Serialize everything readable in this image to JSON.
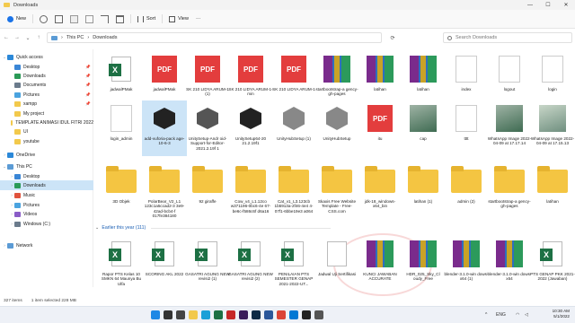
{
  "window": {
    "title": "Downloads",
    "controls": [
      "—",
      "☐",
      "✕"
    ]
  },
  "toolbar": {
    "new_label": "New",
    "sort_label": "Sort",
    "view_label": "View",
    "more_label": "···"
  },
  "address": {
    "crumbs": [
      "This PC",
      "Downloads"
    ],
    "separator": "›",
    "search_placeholder": "Search Downloads"
  },
  "sidebar": {
    "items": [
      {
        "label": "Quick access",
        "color": "#2b88d8",
        "level": 0,
        "chev": "⌄",
        "pin": ""
      },
      {
        "label": "Desktop",
        "color": "#3a86d6",
        "level": 1,
        "chev": "",
        "pin": "📌"
      },
      {
        "label": "Downloads",
        "color": "#2b9a57",
        "level": 1,
        "chev": "",
        "pin": "📌"
      },
      {
        "label": "Documents",
        "color": "#6b7b8c",
        "level": 1,
        "chev": "",
        "pin": "📌"
      },
      {
        "label": "Pictures",
        "color": "#4aa3df",
        "level": 1,
        "chev": "",
        "pin": "📌"
      },
      {
        "label": "xampp",
        "color": "#f2c94c",
        "level": 1,
        "chev": "",
        "pin": "📌"
      },
      {
        "label": "My project",
        "color": "#f2c94c",
        "level": 1,
        "chev": "",
        "pin": ""
      },
      {
        "label": "TEMPLATE ANIMASI IDUL FITRI 2022",
        "color": "#f2c94c",
        "level": 1,
        "chev": "",
        "pin": ""
      },
      {
        "label": "UI",
        "color": "#f2c94c",
        "level": 1,
        "chev": "",
        "pin": ""
      },
      {
        "label": "youtube",
        "color": "#f2c94c",
        "level": 1,
        "chev": "",
        "pin": ""
      },
      {
        "label": "OneDrive",
        "color": "#2b88d8",
        "level": 0,
        "chev": "›",
        "pin": ""
      },
      {
        "label": "This PC",
        "color": "#5b9bd5",
        "level": 0,
        "chev": "⌄",
        "pin": ""
      },
      {
        "label": "Desktop",
        "color": "#3a86d6",
        "level": 1,
        "chev": "›",
        "pin": ""
      },
      {
        "label": "Downloads",
        "color": "#2b9a57",
        "level": 1,
        "chev": "›",
        "pin": "",
        "active": true
      },
      {
        "label": "Music",
        "color": "#e0533d",
        "level": 1,
        "chev": "›",
        "pin": ""
      },
      {
        "label": "Pictures",
        "color": "#4aa3df",
        "level": 1,
        "chev": "›",
        "pin": ""
      },
      {
        "label": "Videos",
        "color": "#8a5cc7",
        "level": 1,
        "chev": "›",
        "pin": ""
      },
      {
        "label": "Windows (C:)",
        "color": "#6b7b8c",
        "level": 1,
        "chev": "›",
        "pin": ""
      },
      {
        "label": "Network",
        "color": "#5b9bd5",
        "level": 0,
        "chev": "›",
        "pin": ""
      }
    ]
  },
  "files_row1": [
    {
      "label": "jadwalPMak",
      "kind": "xlsx"
    },
    {
      "label": "jadwalPMak",
      "kind": "pdf"
    },
    {
      "label": "SK 210 LIDYA ARUM-1 (1)",
      "kind": "pdf"
    },
    {
      "label": "SK 210 LIDYA ARUM-1-min",
      "kind": "pdf"
    },
    {
      "label": "SK 210 LIDYA ARUM-1",
      "kind": "pdf"
    },
    {
      "label": "startbootstrap-a gency-gh-pages",
      "kind": "rar"
    },
    {
      "label": "latihan",
      "kind": "rar"
    },
    {
      "label": "latihan",
      "kind": "rar"
    },
    {
      "label": "index",
      "kind": "html"
    },
    {
      "label": "logout",
      "kind": "html"
    },
    {
      "label": "login",
      "kind": "html"
    }
  ],
  "files_row2": [
    {
      "label": "login_admin",
      "kind": "html"
    },
    {
      "label": "add-vuforia-pack age-10-6-3",
      "kind": "unity",
      "selected": true
    },
    {
      "label": "UnitySetup-Andr oid-Support-for-Editor-2021.2.19f 1",
      "kind": "unity2"
    },
    {
      "label": "UnitySetup64-20 21.2.19f1",
      "kind": "unity"
    },
    {
      "label": "UnityHubSetup (1)",
      "kind": "setup"
    },
    {
      "label": "UnityHubSetup",
      "kind": "setup"
    },
    {
      "label": "itu",
      "kind": "pdf"
    },
    {
      "label": "cap",
      "kind": "photo"
    },
    {
      "label": "tttt",
      "kind": "html"
    },
    {
      "label": "WhatsApp Image 2022-04-09 at 17.17.14",
      "kind": "photo"
    },
    {
      "label": "WhatsApp Image 2022-04-09 at 17.15.13",
      "kind": "photo2"
    }
  ],
  "files_row3": [
    {
      "label": "3D Objek",
      "kind": "folder"
    },
    {
      "label": "PolarBear_V2_L1 123c1a5ccad2-3 3e9-42ad-bcb4-f 017fe384180",
      "kind": "folder"
    },
    {
      "label": "92 giraffe",
      "kind": "folder"
    },
    {
      "label": "Cow_v4_L1.12co w371196-0bc6-4e 67-be6c-f586c6f d6a16",
      "kind": "folder"
    },
    {
      "label": "Cat_v1_L3.123cb 1b5913a-2f46-4e4 4-07f1-6bbe19e3 a064",
      "kind": "folder"
    },
    {
      "label": "Skaxis Free Website Template - Free-CSS.com",
      "kind": "folder"
    },
    {
      "label": "jdk-18_windows-x64_bin",
      "kind": "folder"
    },
    {
      "label": "latihan (1)",
      "kind": "folder"
    },
    {
      "label": "admin (2)",
      "kind": "folder"
    },
    {
      "label": "startbootstrap-a gency-gh-pages",
      "kind": "folder"
    },
    {
      "label": "latihan",
      "kind": "folder"
    }
  ],
  "group": {
    "header": "Earlier this year (111)"
  },
  "files_row4": [
    {
      "label": "Rapor PTS Kelas 10 SMKN 64 Maunya Bu Ulfa",
      "kind": "xlsx"
    },
    {
      "label": "SCORING AKL 2022",
      "kind": "xlsx"
    },
    {
      "label": "GASATRI AGUNG NEW revisi2 (1)",
      "kind": "xlsx"
    },
    {
      "label": "GASATRI AGUNG NEW revisi2 (2)",
      "kind": "xlsx"
    },
    {
      "label": "PENILAIAN PTS SEMESTER GENAP 2021-2022-UT...",
      "kind": "xlsx"
    },
    {
      "label": "Jadwal Uji Sertifikasi",
      "kind": "doc"
    },
    {
      "label": "KUNCI JAWABAN ACCURATE",
      "kind": "rar"
    },
    {
      "label": "HDR_025_Sky_Cl oudy_Free",
      "kind": "rar"
    },
    {
      "label": "blender-3.1.0-win dows-x64 (1)",
      "kind": "rar"
    },
    {
      "label": "blender-3.1.0-win dows-x64",
      "kind": "rar"
    },
    {
      "label": "PTS GENAP PKK 2021-2022 (Jawaban)",
      "kind": "xlsx"
    }
  ],
  "status": {
    "count": "327 items",
    "selected": "1 item selected  228 MB"
  },
  "taskbar": {
    "time": "10:30 AM",
    "date": "5/1/2022",
    "lang": "ENG",
    "icons": [
      {
        "name": "start-icon",
        "color": "#1e88e5"
      },
      {
        "name": "search-icon",
        "color": "#333333"
      },
      {
        "name": "task-view-icon",
        "color": "#444444"
      },
      {
        "name": "explorer-icon",
        "color": "#f2c94c"
      },
      {
        "name": "edge-icon",
        "color": "#1aa0d8"
      },
      {
        "name": "excel-icon",
        "color": "#1d7044"
      },
      {
        "name": "pdf-icon",
        "color": "#c62828"
      },
      {
        "name": "premiere-icon",
        "color": "#3a1c5a"
      },
      {
        "name": "photoshop-icon",
        "color": "#0d2a46"
      },
      {
        "name": "word-icon",
        "color": "#2b579a"
      },
      {
        "name": "chrome-icon",
        "color": "#db4437"
      },
      {
        "name": "vscode-icon",
        "color": "#0078d4"
      },
      {
        "name": "unity-icon",
        "color": "#222222"
      },
      {
        "name": "terminal-icon",
        "color": "#555555"
      }
    ]
  }
}
